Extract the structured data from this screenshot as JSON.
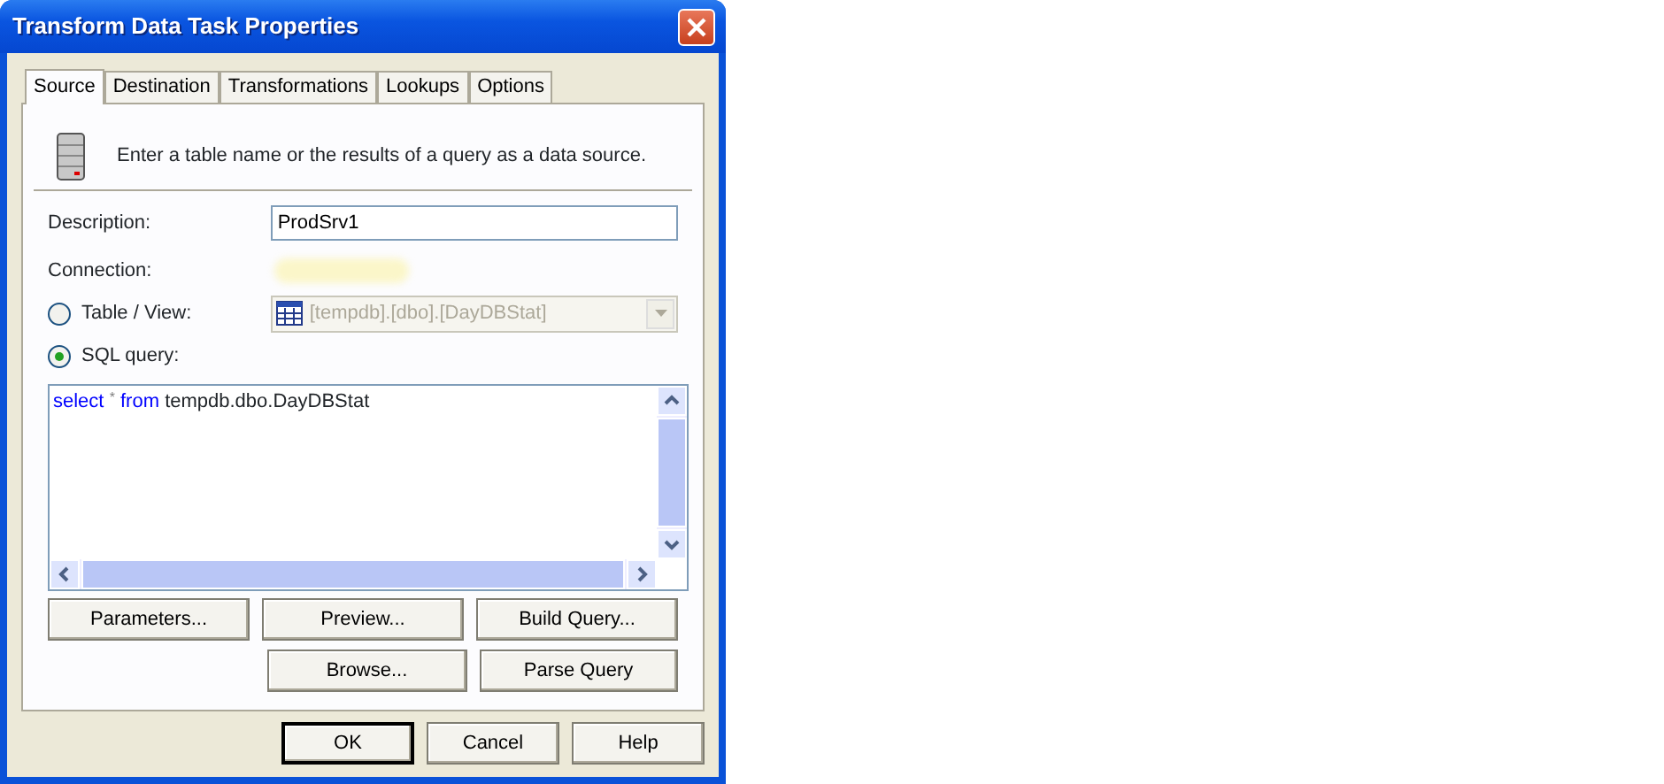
{
  "window": {
    "title": "Transform Data Task Properties"
  },
  "tabs": [
    {
      "label": "Source",
      "selected": true
    },
    {
      "label": "Destination",
      "selected": false
    },
    {
      "label": "Transformations",
      "selected": false
    },
    {
      "label": "Lookups",
      "selected": false
    },
    {
      "label": "Options",
      "selected": false
    }
  ],
  "header": {
    "text": "Enter a table name or the results of a query as a data source."
  },
  "description": {
    "label": "Description:",
    "value": "ProdSrv1"
  },
  "connection": {
    "label": "Connection:"
  },
  "sources": [
    {
      "label": "Table / View:",
      "selected": false,
      "kind": "combo",
      "value": "[tempdb].[dbo].[DayDBStat]",
      "disabled": true
    },
    {
      "label": "SQL query:",
      "selected": true,
      "kind": "query"
    }
  ],
  "query": [
    {
      "text": "select",
      "kind": "keyword"
    },
    {
      "text": "*",
      "kind": "operator"
    },
    {
      "text": "from",
      "kind": "keyword"
    },
    {
      "text": "tempdb.dbo.DayDBStat",
      "kind": "identifier"
    }
  ],
  "query_buttons": [
    [
      "Parameters...",
      "Preview...",
      "Build Query..."
    ],
    [
      "Browse...",
      "Parse Query"
    ]
  ],
  "buttons": [
    {
      "label": "OK",
      "default": true
    },
    {
      "label": "Cancel",
      "default": false
    },
    {
      "label": "Help",
      "default": false
    }
  ]
}
